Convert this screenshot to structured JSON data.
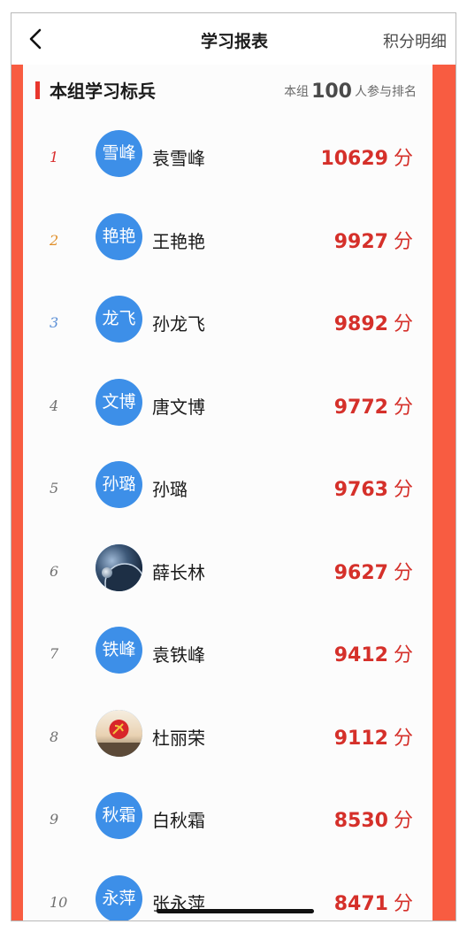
{
  "header": {
    "title": "学习报表",
    "right_action": "积分明细"
  },
  "section": {
    "title": "本组学习标兵",
    "count_prefix": "本组",
    "count_value": "100",
    "count_suffix": "人参与排名"
  },
  "colors": {
    "accent": "#f85c41",
    "score": "#d5302a",
    "avatar": "#3d8fe8",
    "rank1": "#d92d2d",
    "rank2": "#e08f2a",
    "rank3": "#5b8fd6"
  },
  "members": [
    {
      "rank": "1",
      "avatar_text": "雪峰",
      "name": "袁雪峰",
      "score": "10629",
      "unit": "分"
    },
    {
      "rank": "2",
      "avatar_text": "艳艳",
      "name": "王艳艳",
      "score": "9927",
      "unit": "分"
    },
    {
      "rank": "3",
      "avatar_text": "龙飞",
      "name": "孙龙飞",
      "score": "9892",
      "unit": "分"
    },
    {
      "rank": "4",
      "avatar_text": "文博",
      "name": "唐文博",
      "score": "9772",
      "unit": "分"
    },
    {
      "rank": "5",
      "avatar_text": "孙璐",
      "name": "孙璐",
      "score": "9763",
      "unit": "分"
    },
    {
      "rank": "6",
      "avatar_icon": "planet-photo-avatar",
      "name": "薛长林",
      "score": "9627",
      "unit": "分"
    },
    {
      "rank": "7",
      "avatar_text": "铁峰",
      "name": "袁铁峰",
      "score": "9412",
      "unit": "分"
    },
    {
      "rank": "8",
      "avatar_icon": "party-emblem-photo-avatar",
      "name": "杜丽荣",
      "score": "9112",
      "unit": "分"
    },
    {
      "rank": "9",
      "avatar_text": "秋霜",
      "name": "白秋霜",
      "score": "8530",
      "unit": "分"
    },
    {
      "rank": "10",
      "avatar_text": "永萍",
      "name": "张永萍",
      "score": "8471",
      "unit": "分"
    }
  ]
}
